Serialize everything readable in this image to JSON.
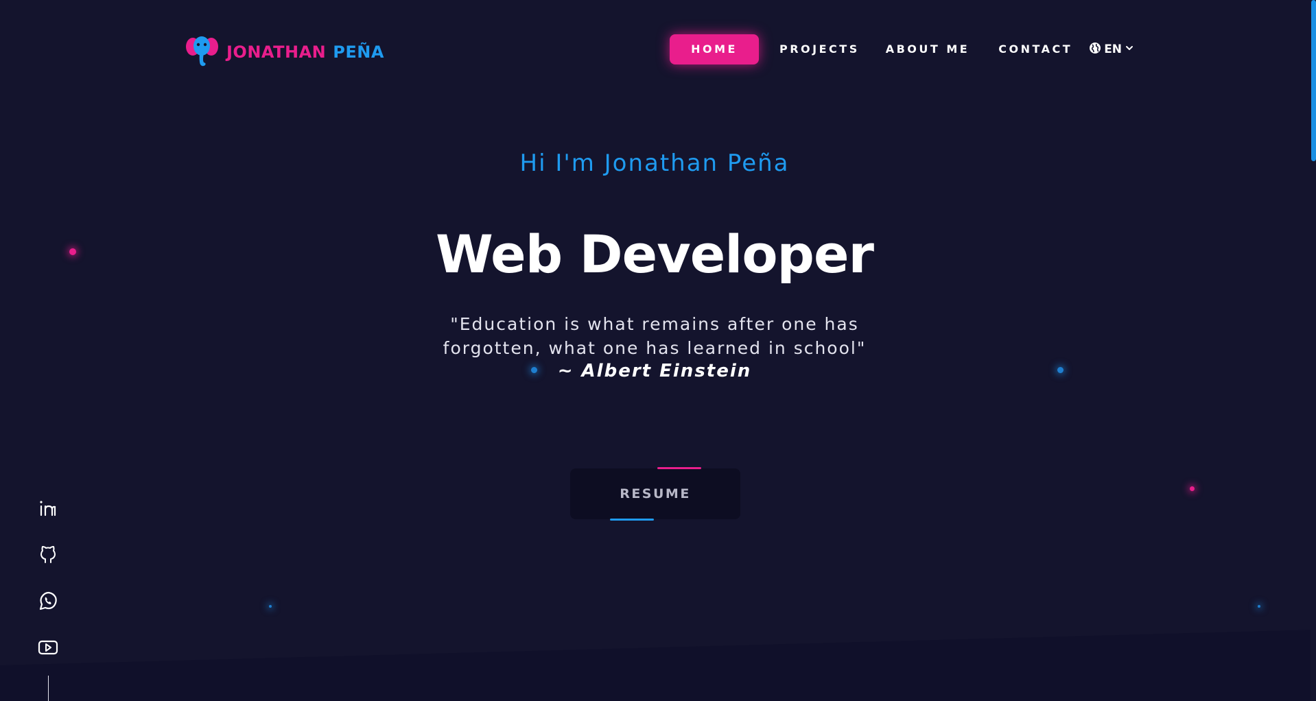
{
  "brand": {
    "first_name": "JONATHAN",
    "last_name": "PEÑA",
    "colors": {
      "pink": "#e91e8c",
      "blue": "#1f9bf0",
      "background": "#14142d"
    }
  },
  "nav": {
    "items": [
      {
        "label": "HOME",
        "active": true
      },
      {
        "label": "PROJECTS",
        "active": false
      },
      {
        "label": "ABOUT ME",
        "active": false
      },
      {
        "label": "CONTACT",
        "active": false
      }
    ],
    "language": {
      "icon": "globe-icon",
      "label": "EN"
    }
  },
  "hero": {
    "greeting": "Hi I'm Jonathan Peña",
    "title": "Web Developer",
    "quote_line1": "\"Education is what remains after one has",
    "quote_line2": "forgotten, what one has learned in school\"",
    "author": "~ Albert Einstein",
    "resume_label": "RESUME"
  },
  "social": [
    {
      "name": "linkedin-icon"
    },
    {
      "name": "github-icon"
    },
    {
      "name": "whatsapp-icon"
    },
    {
      "name": "youtube-icon"
    }
  ]
}
